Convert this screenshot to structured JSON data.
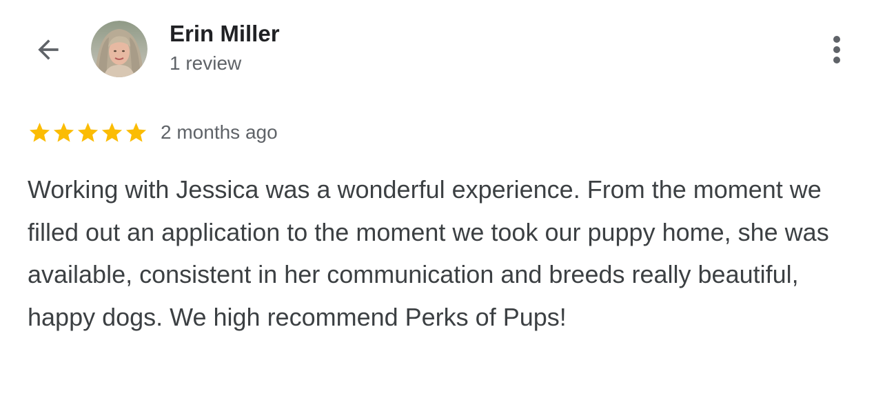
{
  "header": {
    "back_icon": "arrow-left-icon",
    "avatar_icon": "reviewer-avatar",
    "reviewer_name": "Erin Miller",
    "review_count": "1 review",
    "more_icon": "more-vert-icon"
  },
  "review": {
    "rating": 5,
    "max_rating": 5,
    "star_color": "#fbbc04",
    "date": "2 months ago",
    "text": "Working with Jessica was a wonderful experience. From the moment we filled out an application to the moment we took our puppy home, she was available, consistent in her communication and breeds really beautiful, happy dogs. We high recommend Perks of Pups!"
  },
  "colors": {
    "name_text": "#202124",
    "secondary_text": "#5f6368",
    "body_text": "#3c4043",
    "icon": "#5f6368"
  }
}
